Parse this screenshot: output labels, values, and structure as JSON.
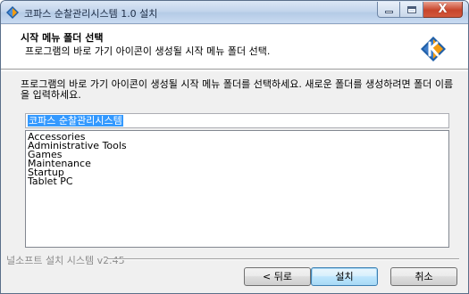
{
  "window": {
    "title": "코파스 순찰관리시스템 1.0 설치",
    "controls": {
      "minimize": "minimize",
      "maximize": "maximize",
      "close": "X"
    }
  },
  "header": {
    "title": "시작 메뉴 폴더 선택",
    "subtitle": "프로그램의 바로 가기 아이콘이 생성될 시작 메뉴 폴더 선택."
  },
  "body": {
    "instruction": "프로그램의 바로 가기 아이콘이 생성될 시작 메뉴 폴더를 선택하세요. 새로운 폴더를 생성하려면 폴더 이름을 입력하세요.",
    "folder_input_value": "코파스 순찰관리시스템",
    "folders": [
      "Accessories",
      "Administrative Tools",
      "Games",
      "Maintenance",
      "Startup",
      "Tablet PC"
    ]
  },
  "footer": {
    "branding": "널소프트 설치 시스템 v2.45",
    "back_label": "< 뒤로",
    "install_label": "설치",
    "cancel_label": "취소"
  },
  "colors": {
    "selection": "#3399ff",
    "logo_orange": "#f39c12",
    "logo_blue": "#1f5fa8"
  }
}
